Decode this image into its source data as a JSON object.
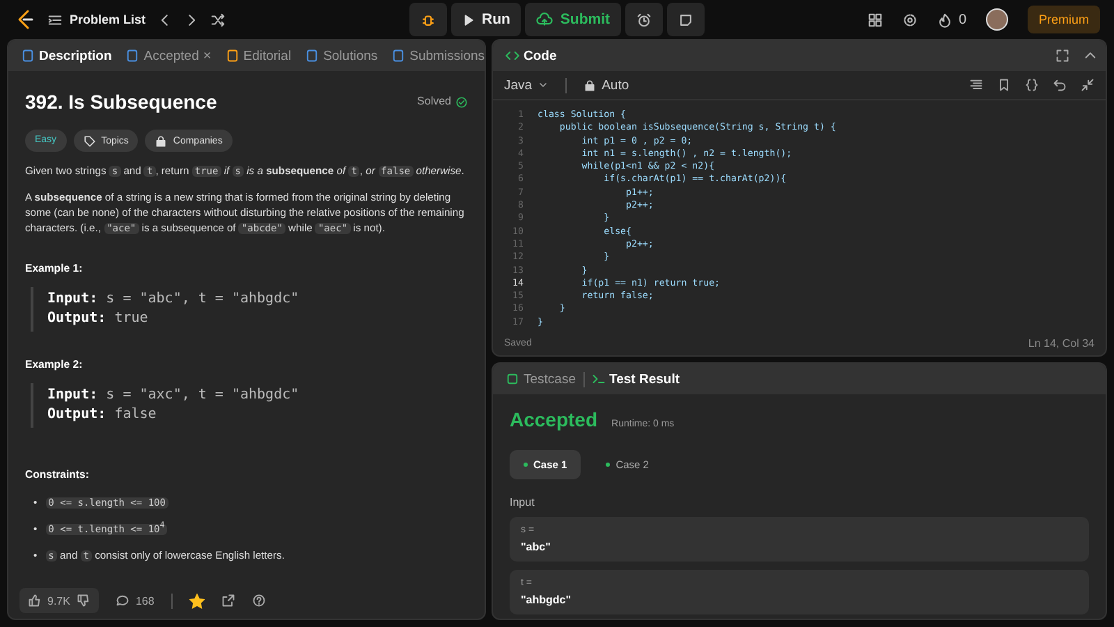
{
  "top_bar": {
    "problem_list": "Problem List",
    "run": "Run",
    "submit": "Submit",
    "streak": "0",
    "premium": "Premium"
  },
  "description_tabs": [
    {
      "label": "Description",
      "selected": true
    },
    {
      "label": "Accepted",
      "selected": false,
      "close": "×"
    },
    {
      "label": "Editorial",
      "selected": false
    },
    {
      "label": "Solutions",
      "selected": false
    },
    {
      "label": "Submissions",
      "selected": false
    }
  ],
  "problem": {
    "title": "392. Is Subsequence",
    "status": "Solved",
    "difficulty": "Easy",
    "tags": [
      {
        "label": "Topics",
        "kind": "tag"
      },
      {
        "label": "Companies",
        "kind": "lock"
      }
    ],
    "paragraphs": [
      [
        {
          "kind": "text",
          "text": "Given two strings "
        },
        {
          "kind": "code",
          "text": "s"
        },
        {
          "kind": "text",
          "text": " and "
        },
        {
          "kind": "code",
          "text": "t"
        },
        {
          "kind": "text",
          "text": ", return "
        },
        {
          "kind": "code",
          "text": "true"
        },
        {
          "kind": "text",
          "text": " *if* "
        },
        {
          "kind": "code",
          "text": "s"
        },
        {
          "kind": "text",
          "text": " *is a* **subsequence** *of* "
        },
        {
          "kind": "code",
          "text": "t"
        },
        {
          "kind": "text",
          "text": ", *or* "
        },
        {
          "kind": "code",
          "text": "false"
        },
        {
          "kind": "text",
          "text": " *otherwise*."
        }
      ],
      [
        {
          "kind": "text",
          "text": "A **subsequence** of a string is a new string that is formed from the original string by deleting some (can be none) of the characters without disturbing the relative positions of the remaining characters. (i.e., "
        },
        {
          "kind": "code",
          "text": "\"ace\""
        },
        {
          "kind": "text",
          "text": " is a subsequence of "
        },
        {
          "kind": "code",
          "text": "\"abcde\""
        },
        {
          "kind": "text",
          "text": " while "
        },
        {
          "kind": "code",
          "text": "\"aec\""
        },
        {
          "kind": "text",
          "text": " is not)."
        }
      ]
    ],
    "examples": [
      {
        "title": "Example 1:",
        "input_label": "Input:",
        "input": "s = \"abc\", t = \"ahbgdc\"",
        "output_label": "Output:",
        "output": "true"
      },
      {
        "title": "Example 2:",
        "input_label": "Input:",
        "input": "s = \"axc\", t = \"ahbgdc\"",
        "output_label": "Output:",
        "output": "false"
      }
    ],
    "constraints_title": "Constraints:",
    "constraints": [
      {
        "bullet": "•",
        "parts": [
          {
            "kind": "code",
            "text": "0 <= s.length <= 100"
          }
        ]
      },
      {
        "bullet": "•",
        "parts": [
          {
            "kind": "code",
            "text": "0 <= t.length <= 10$^{4}$"
          }
        ]
      },
      {
        "bullet": "•",
        "parts": [
          {
            "kind": "code",
            "text": "s"
          },
          {
            "kind": "text",
            "text": " and "
          },
          {
            "kind": "code",
            "text": "t"
          },
          {
            "kind": "text",
            "text": " consist only of lowercase English letters."
          }
        ]
      }
    ]
  },
  "description_footer": {
    "likes": "9.7K",
    "comments": "168",
    "favorited": true
  },
  "editor": {
    "title": "Code",
    "language": "Java",
    "mode": "Auto",
    "status": "Saved",
    "cursor": "Ln 14, Col 34",
    "lines": [
      {
        "number": "1",
        "code": "class Solution {",
        "active": false
      },
      {
        "number": "2",
        "code": "    public boolean isSubsequence(String s, String t) {",
        "active": false
      },
      {
        "number": "3",
        "code": "        int p1 = 0 , p2 = 0;",
        "active": false
      },
      {
        "number": "4",
        "code": "        int n1 = s.length() , n2 = t.length();",
        "active": false
      },
      {
        "number": "5",
        "code": "        while(p1<n1 && p2 < n2){",
        "active": false
      },
      {
        "number": "6",
        "code": "            if(s.charAt(p1) == t.charAt(p2)){",
        "active": false
      },
      {
        "number": "7",
        "code": "                p1++;",
        "active": false
      },
      {
        "number": "8",
        "code": "                p2++;",
        "active": false
      },
      {
        "number": "9",
        "code": "            }",
        "active": false
      },
      {
        "number": "10",
        "code": "            else{",
        "active": false
      },
      {
        "number": "11",
        "code": "                p2++;",
        "active": false
      },
      {
        "number": "12",
        "code": "            }",
        "active": false
      },
      {
        "number": "13",
        "code": "        }",
        "active": false
      },
      {
        "number": "14",
        "code": "        if(p1 == n1) return true;",
        "active": true
      },
      {
        "number": "15",
        "code": "        return false;",
        "active": false
      },
      {
        "number": "16",
        "code": "    }",
        "active": false
      },
      {
        "number": "17",
        "code": "}",
        "active": false
      }
    ]
  },
  "result": {
    "tabs": [
      {
        "label": "Testcase",
        "selected": false
      },
      {
        "label": "Test Result",
        "selected": true
      }
    ],
    "verdict": "Accepted",
    "runtime": "Runtime: 0 ms",
    "cases": [
      {
        "label": "Case 1",
        "selected": true
      },
      {
        "label": "Case 2",
        "selected": false
      }
    ],
    "input_label": "Input",
    "inputs": [
      {
        "name": "s =",
        "value": "\"abc\""
      },
      {
        "name": "t =",
        "value": "\"ahbgdc\""
      }
    ]
  }
}
